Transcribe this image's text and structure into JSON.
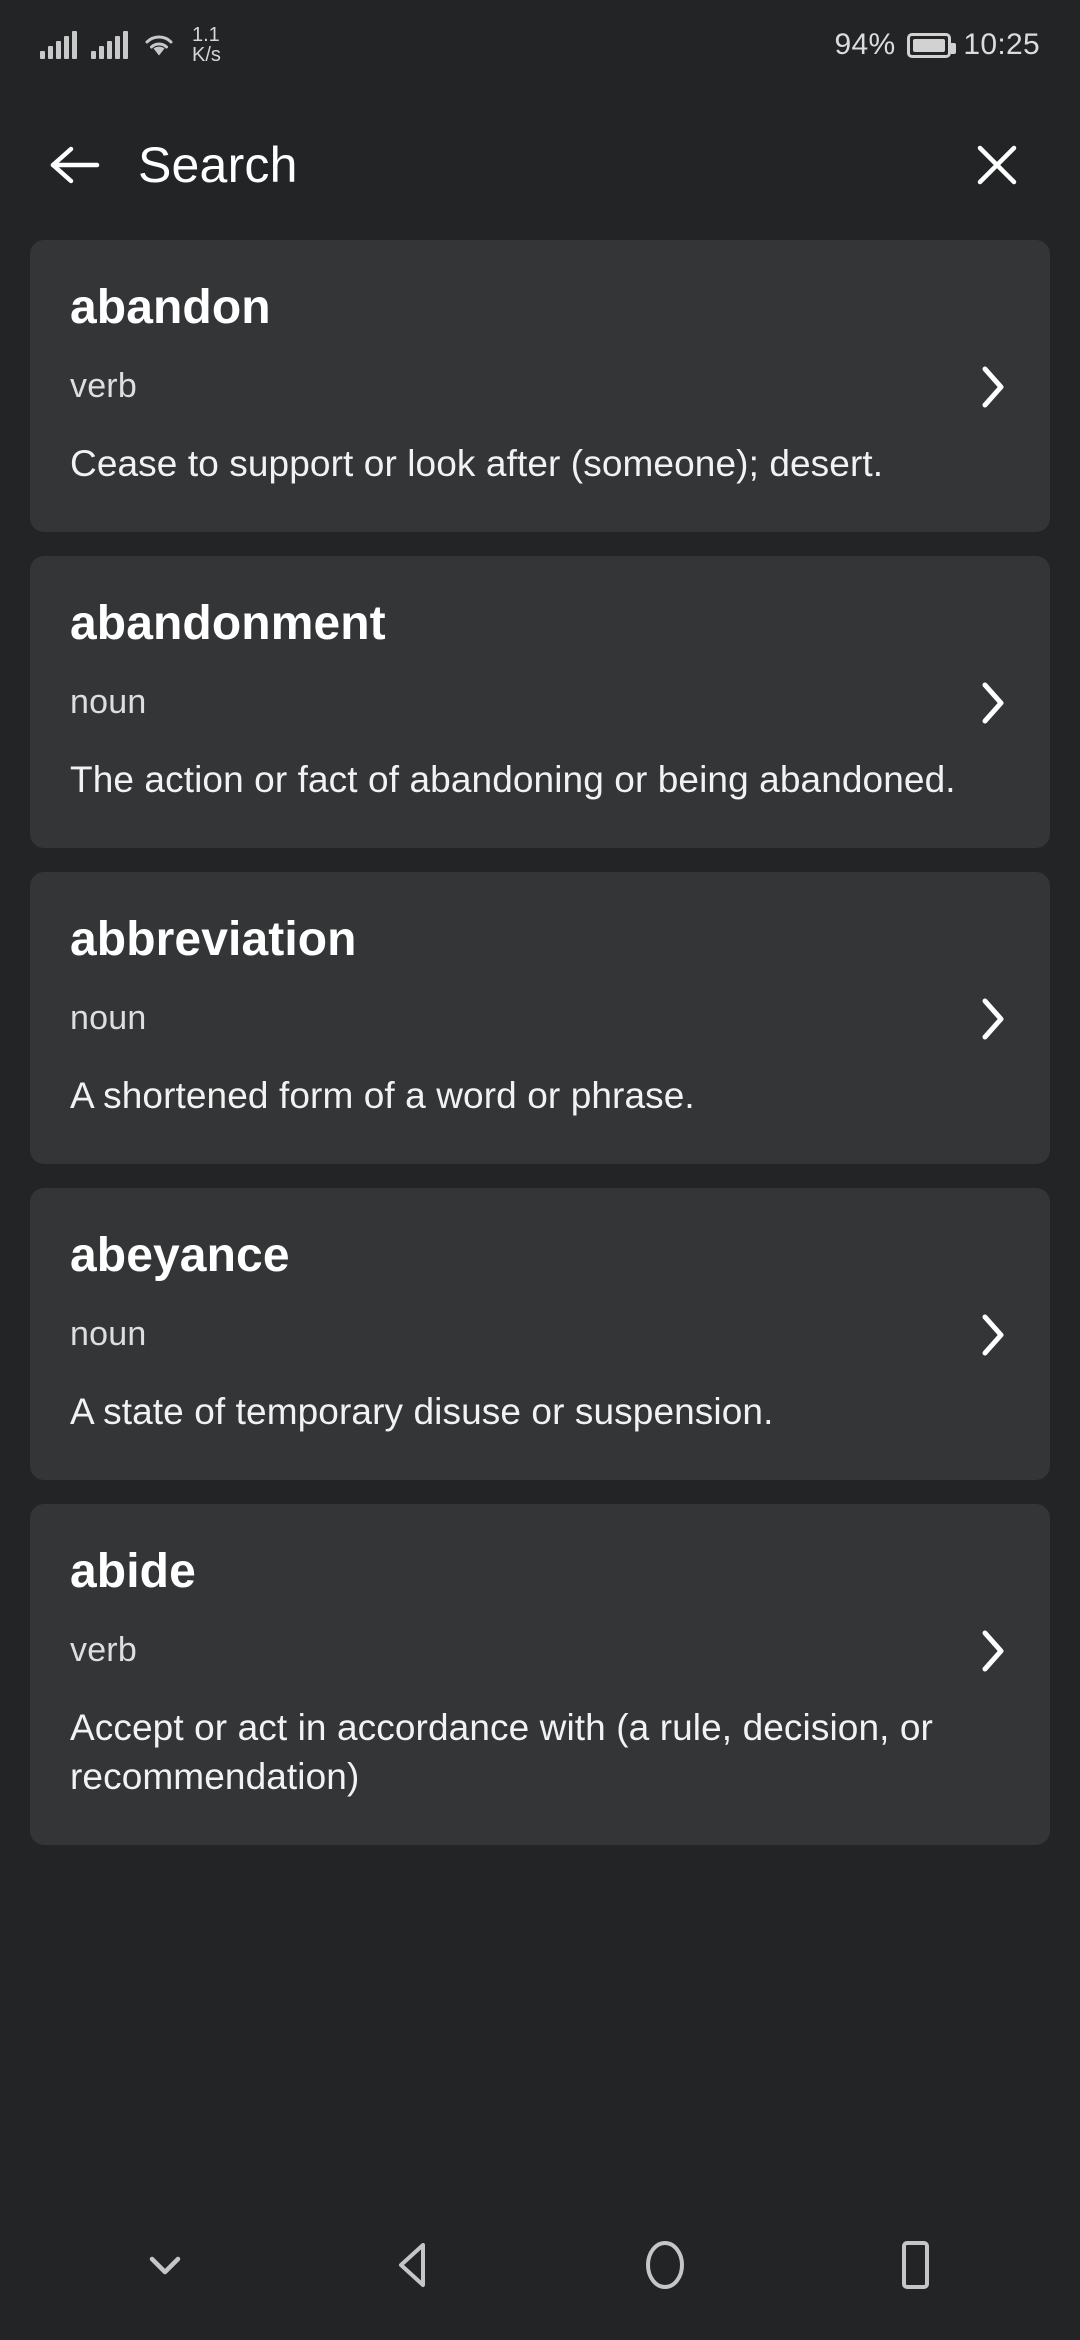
{
  "status_bar": {
    "network_speed_value": "1.1",
    "network_speed_unit": "K/s",
    "battery_percent": "94%",
    "time": "10:25",
    "icons": [
      "signal-bars-icon",
      "signal-bars-icon",
      "wifi-icon",
      "battery-icon"
    ]
  },
  "app_bar": {
    "back_icon": "back-arrow-icon",
    "title": "Search",
    "close_icon": "close-icon"
  },
  "results": [
    {
      "word": "abandon",
      "part_of_speech": "verb",
      "definition": "Cease to support or look after (someone); desert.",
      "chevron_icon": "chevron-right-icon"
    },
    {
      "word": "abandonment",
      "part_of_speech": "noun",
      "definition": "The action or fact of abandoning or being abandoned.",
      "chevron_icon": "chevron-right-icon"
    },
    {
      "word": "abbreviation",
      "part_of_speech": "noun",
      "definition": "A shortened form of a word or phrase.",
      "chevron_icon": "chevron-right-icon"
    },
    {
      "word": "abeyance",
      "part_of_speech": "noun",
      "definition": "A state of temporary disuse or suspension.",
      "chevron_icon": "chevron-right-icon"
    },
    {
      "word": "abide",
      "part_of_speech": "verb",
      "definition": "Accept or act in accordance with (a rule, decision, or recommendation)",
      "chevron_icon": "chevron-right-icon"
    }
  ],
  "nav_bar": {
    "hide_keyboard_icon": "chevron-down-icon",
    "back_icon": "triangle-back-icon",
    "home_icon": "circle-home-icon",
    "recents_icon": "square-recents-icon"
  },
  "colors": {
    "background": "#222426",
    "card": "#333537",
    "text_primary": "#ffffff",
    "text_secondary": "#dedede",
    "icon": "#c9c9c9"
  }
}
